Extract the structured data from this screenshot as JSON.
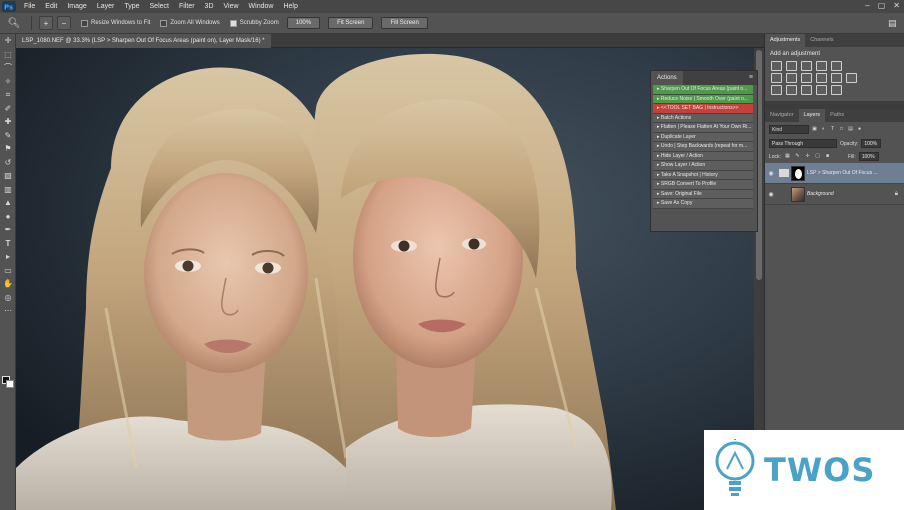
{
  "menubar": {
    "items": [
      "File",
      "Edit",
      "Image",
      "Layer",
      "Type",
      "Select",
      "Filter",
      "3D",
      "View",
      "Window",
      "Help"
    ],
    "window_controls": [
      "–",
      "▢",
      "✕"
    ]
  },
  "options": {
    "resize_windows_to_fit": "Resize Windows to Fit",
    "zoom_all_windows": "Zoom All Windows",
    "scrubby_zoom": "Scrubby Zoom",
    "zoom_pct": "100%",
    "fit_screen": "Fit Screen",
    "fill_screen": "Fill Screen"
  },
  "document": {
    "tab_title": "LSP_1080.NEF @ 33.3% (LSP > Sharpen Out Of Focus Areas (paint on), Layer Mask/16) *"
  },
  "actions_panel": {
    "title": "Actions",
    "items": [
      {
        "label": "Sharpen Out Of Focus Areas (paint o...",
        "state": "green"
      },
      {
        "label": "Reduce Noise | Smooth Over (paint o...",
        "state": "green"
      },
      {
        "label": "<<TOOL SET BAG | Instructions>>",
        "state": "red"
      },
      {
        "label": "Batch Actions",
        "state": "gray"
      },
      {
        "label": "Flatten | Please Flatten At Your Own Ri...",
        "state": "gray"
      },
      {
        "label": "Duplicate Layer",
        "state": "gray"
      },
      {
        "label": "Undo | Step Backwards (repeat for m...",
        "state": "gray"
      },
      {
        "label": "Hide Layer / Action",
        "state": "gray"
      },
      {
        "label": "Show Layer / Action",
        "state": "gray"
      },
      {
        "label": "Take A Snapshot | History",
        "state": "gray"
      },
      {
        "label": "SRGB Convert To Profile",
        "state": "gray"
      },
      {
        "label": "Save: Original File",
        "state": "gray"
      },
      {
        "label": "Save As Copy",
        "state": "gray"
      }
    ]
  },
  "panels": {
    "adjustments_tab": "Adjustments",
    "channels_tab": "Channels",
    "add_adjustment": "Add an adjustment",
    "navigator_tab": "Navigator",
    "layers_tab": "Layers",
    "paths_tab": "Paths",
    "kind": "Kind",
    "blend_mode": "Pass Through",
    "opacity_label": "Opacity:",
    "opacity": "100%",
    "lock_label": "Lock:",
    "fill_label": "Fill:",
    "fill": "100%",
    "layers": [
      {
        "name": "LSP > Sharpen Out Of Focus ...",
        "selected": true
      },
      {
        "name": "Background",
        "selected": false
      }
    ]
  },
  "watermark": {
    "text": "TWOS",
    "color": "#4aa3c7"
  },
  "colors": {
    "action_green": "#4d9a49",
    "action_red": "#c4403c",
    "selected_layer": "#6e7f94"
  }
}
